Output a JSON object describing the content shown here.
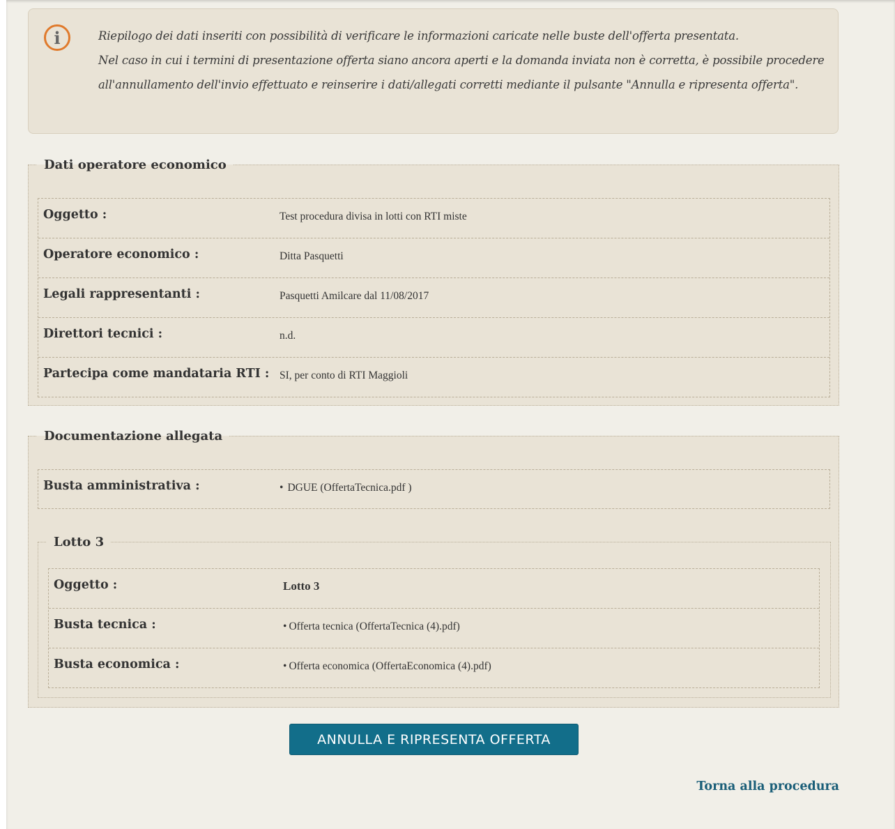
{
  "info": {
    "line1": "Riepilogo dei dati inseriti con possibilità di verificare le informazioni caricate nelle buste dell'offerta presentata.",
    "line2": "Nel caso in cui i termini di presentazione offerta siano ancora aperti e la domanda inviata non è corretta, è possibile procedere all'annullamento dell'invio effettuato e reinserire i dati/allegati corretti mediante il pulsante \"Annulla e ripresenta offerta\".",
    "icon": "info-icon",
    "icon_glyph": "i",
    "icon_color": "#e07a2c"
  },
  "operatore": {
    "legend": "Dati operatore economico",
    "rows": [
      {
        "label": "Oggetto :",
        "value": "Test procedura divisa in lotti con RTI miste"
      },
      {
        "label": "Operatore economico :",
        "value": "Ditta Pasquetti"
      },
      {
        "label": "Legali rappresentanti :",
        "value": "Pasquetti Amilcare dal 11/08/2017"
      },
      {
        "label": "Direttori tecnici :",
        "value": "n.d."
      },
      {
        "label": "Partecipa come mandataria RTI :",
        "value": "SI, per conto di RTI Maggioli"
      }
    ]
  },
  "documentazione": {
    "legend": "Documentazione allegata",
    "busta_amministrativa": {
      "label": "Busta amministrativa :",
      "bullet": "•",
      "value": "DGUE  (OffertaTecnica.pdf )"
    },
    "lotto": {
      "legend": "Lotto 3",
      "rows": [
        {
          "label": "Oggetto :",
          "value": "Lotto 3"
        },
        {
          "label": "Busta tecnica :",
          "bullet": "•",
          "value": "Offerta tecnica  (OffertaTecnica (4).pdf)"
        },
        {
          "label": "Busta economica :",
          "bullet": "•",
          "value": "Offerta economica  (OffertaEconomica (4).pdf)"
        }
      ]
    }
  },
  "actions": {
    "annulla_label": "ANNULLA E RIPRESENTA OFFERTA",
    "back_label": "Torna alla procedura",
    "button_color": "#126e8a",
    "link_color": "#1a5e78"
  }
}
